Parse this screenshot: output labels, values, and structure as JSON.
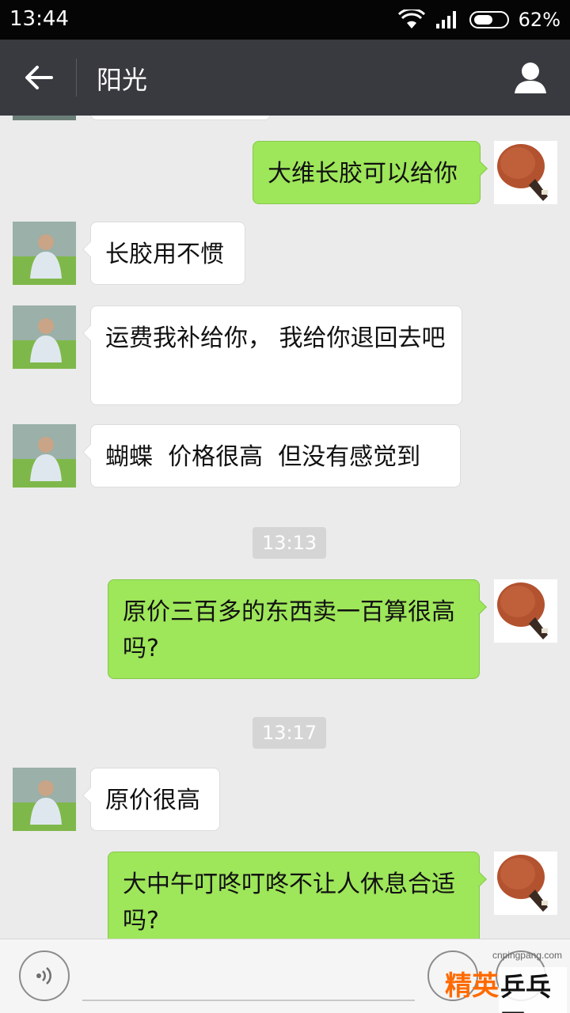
{
  "status_bar": {
    "time": "13:44",
    "battery_text": "62%",
    "battery_level": 0.62,
    "icons": [
      "wifi-icon",
      "signal-icon",
      "battery-icon"
    ]
  },
  "header": {
    "title": "阳光",
    "back_icon": "back-arrow-icon",
    "profile_icon": "person-icon"
  },
  "messages": [
    {
      "type": "out",
      "text": "大维长胶可以给你"
    },
    {
      "type": "in",
      "text": "长胶用不惯"
    },
    {
      "type": "in",
      "text": "运费我补给你， 我给你退回去吧"
    },
    {
      "type": "in",
      "text": "蝴蝶  价格很高  但没有感觉到"
    },
    {
      "type": "time",
      "text": "13:13"
    },
    {
      "type": "out",
      "text": "原价三百多的东西卖一百算很高吗?"
    },
    {
      "type": "time",
      "text": "13:17"
    },
    {
      "type": "in",
      "text": "原价很高"
    },
    {
      "type": "out",
      "text": "大中午叮咚叮咚不让人休息合适吗?"
    }
  ],
  "input_bar": {
    "placeholder": "",
    "voice_icon": "voice-icon",
    "emoji_icon": "emoji-icon",
    "more_icon": "plus-icon"
  },
  "watermark": {
    "url": "cnpingpang.com",
    "logo_text_1": "精英",
    "logo_text_2": "乒乓网"
  },
  "colors": {
    "title_bar": "#393a3f",
    "outgoing_bubble": "#9ee65a",
    "incoming_bubble": "#ffffff",
    "background": "#ebebeb"
  }
}
